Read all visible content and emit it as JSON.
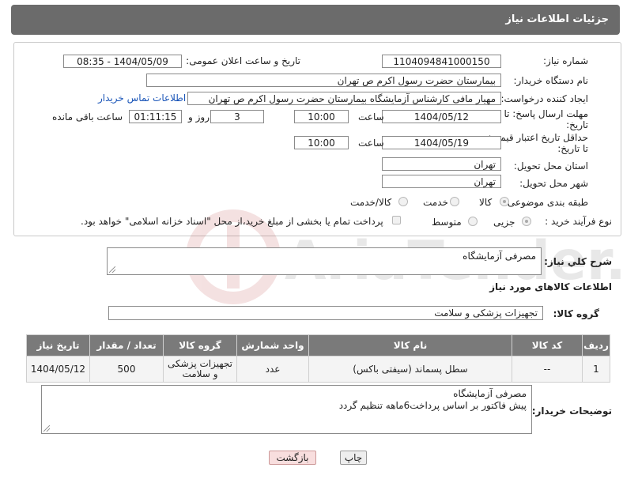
{
  "header": {
    "title": "جزئیات اطلاعات نیاز"
  },
  "form": {
    "need_number_label": "شماره نیاز:",
    "need_number": "1104094841000150",
    "announce_label": "تاریخ و ساعت اعلان عمومی:",
    "announce_value": "1404/05/09 - 08:35",
    "buyer_org_label": "نام دستگاه خریدار:",
    "buyer_org": "بیمارستان حضرت رسول اکرم ص  تهران",
    "creator_label": "ایجاد کننده درخواست:",
    "creator": "مهیار مافی کارشناس آزمایشگاه بیمارستان حضرت رسول اکرم ص  تهران",
    "contact_link": "اطلاعات تماس خریدار",
    "deadline_label_1": "مهلت ارسال پاسخ: تا",
    "deadline_label_2": "تاریخ:",
    "deadline_date": "1404/05/12",
    "time_word": "ساعت",
    "deadline_time": "10:00",
    "days_value": "3",
    "days_word": "روز و",
    "remaining_time": "01:11:15",
    "remaining_word": "ساعت باقی مانده",
    "min_price_label_1": "حداقل تاریخ اعتبار قیمت:",
    "min_price_label_2": "تا تاریخ:",
    "price_date": "1404/05/19",
    "price_time": "10:00",
    "province_label": "استان محل تحویل:",
    "province": "تهران",
    "city_label": "شهر محل تحویل:",
    "city": "تهران",
    "category_label": "طبقه بندی موضوعی:",
    "category_options": [
      "کالا",
      "خدمت",
      "کالا/خدمت"
    ],
    "process_label": "نوع فرآیند خرید :",
    "process_options": [
      "جزیی",
      "متوسط"
    ],
    "payment_note": "پرداخت تمام یا بخشی از مبلغ خرید،از محل \"اسناد خزانه اسلامی\" خواهد بود."
  },
  "description": {
    "label": "شرح كلي نياز:",
    "value": "مصرفی آزمایشگاه"
  },
  "goods_info_title": "اطلاعات کالاهای مورد نیاز",
  "goods_group": {
    "label": "گروه کالا:",
    "value": "تجهیزات پزشکی و سلامت"
  },
  "table": {
    "headers": [
      "ردیف",
      "کد کالا",
      "نام کالا",
      "واحد شمارش",
      "گروه کالا",
      "تعداد / مقدار",
      "تاریخ نیاز"
    ],
    "rows": [
      [
        "1",
        "--",
        "سطل پسماند (سیفتی باکس)",
        "عدد",
        "تجهیزات پزشکی و سلامت",
        "500",
        "1404/05/12"
      ]
    ]
  },
  "buyer_notes": {
    "label": "توضیحات خریدار:",
    "line1": "مصرفی آزمایشگاه",
    "line2": "پیش فاکتور بر اساس پرداخت6ماهه تنظیم گردد"
  },
  "buttons": {
    "print": "چاپ",
    "back": "بازگشت"
  },
  "watermark": {
    "text": "AriaTender.neT"
  }
}
